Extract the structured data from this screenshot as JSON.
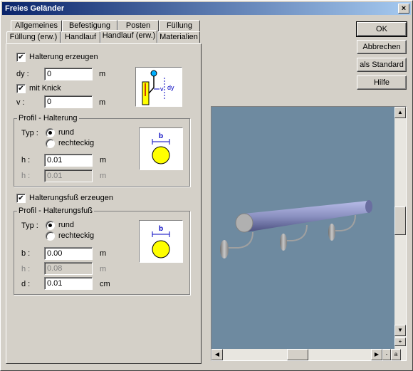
{
  "window": {
    "title": "Freies Geländer",
    "close_glyph": "×"
  },
  "tabs_row1": [
    "Allgemeines",
    "Befestigung",
    "Posten",
    "Füllung"
  ],
  "tabs_row2": [
    "Füllung (erw.)",
    "Handlauf",
    "Handlauf (erw.)",
    "Materialien"
  ],
  "active_tab": "Handlauf (erw.)",
  "halterung": {
    "create_label": "Halterung erzeugen",
    "create_checked": true,
    "dy_label": "dy :",
    "dy_value": "0",
    "dy_unit": "m",
    "knick_label": "mit Knick",
    "knick_checked": true,
    "v_label": "v :",
    "v_value": "0",
    "v_unit": "m",
    "illus_dy": "dy",
    "illus_v": "v"
  },
  "profil_halterung": {
    "title": "Profil - Halterung",
    "typ_label": "Typ :",
    "opt_rund": "rund",
    "opt_rechteckig": "rechteckig",
    "selected": "rund",
    "h_label": "h :",
    "h_value": "0.01",
    "h_unit": "m",
    "h2_label": "h :",
    "h2_value": "0.01",
    "h2_unit": "m",
    "illus_b": "b"
  },
  "fuss": {
    "create_label": "Halterungsfuß erzeugen",
    "create_checked": true
  },
  "profil_fuss": {
    "title": "Profil - Halterungsfuß",
    "typ_label": "Typ :",
    "opt_rund": "rund",
    "opt_rechteckig": "rechteckig",
    "selected": "rund",
    "b_label": "b :",
    "b_value": "0.00",
    "b_unit": "m",
    "h_label": "h :",
    "h_value": "0.08",
    "h_unit": "m",
    "d_label": "d :",
    "d_value": "0.01",
    "d_unit": "cm",
    "illus_b": "b"
  },
  "buttons": {
    "ok": "OK",
    "cancel": "Abbrechen",
    "standard": "als Standard",
    "help": "Hilfe"
  },
  "viewport": {
    "zoom_plus": "+",
    "zoom_minus": "-",
    "zoom_a": "a"
  },
  "colors": {
    "rail": "#8a90c0",
    "viewport_bg": "#6e8aa0",
    "illus_yellow": "#ffff00",
    "illus_blue": "#0000c0"
  }
}
